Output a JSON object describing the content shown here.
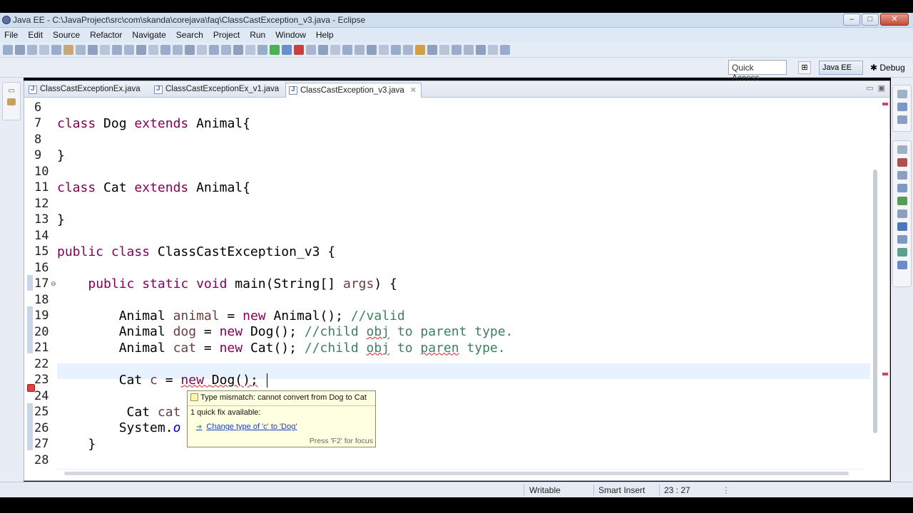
{
  "window": {
    "title": "Java EE - C:\\JavaProject\\src\\com\\skanda\\corejava\\faq\\ClassCastException_v3.java - Eclipse",
    "controls": [
      "–",
      "□",
      "✕"
    ]
  },
  "menu": [
    "File",
    "Edit",
    "Source",
    "Refactor",
    "Navigate",
    "Search",
    "Project",
    "Run",
    "Window",
    "Help"
  ],
  "perspectives": {
    "quick_access": "Quick Access",
    "java_ee": "Java EE",
    "debug": "Debug"
  },
  "tabs": [
    {
      "label": "ClassCastExceptionEx.java"
    },
    {
      "label": "ClassCastExceptionEx_v1.java"
    },
    {
      "label": "ClassCastException_v3.java",
      "close": "✕"
    }
  ],
  "code": {
    "line_numbers": [
      "6",
      "7",
      "8",
      "9",
      "10",
      "11",
      "12",
      "13",
      "14",
      "15",
      "16",
      "17",
      "18",
      "19",
      "20",
      "21",
      "22",
      "23",
      "24",
      "25",
      "26",
      "27",
      "28"
    ]
  },
  "hover": {
    "message": "Type mismatch: cannot convert from Dog to Cat",
    "quick_fix_count": "1 quick fix available:",
    "fix": "Change type of 'c' to 'Dog'",
    "focus_hint": "Press 'F2' for focus"
  },
  "status": {
    "writable": "Writable",
    "insert_mode": "Smart Insert",
    "position": "23 : 27"
  },
  "colors": {
    "keyword": "#7f0055",
    "comment": "#3f7f5f",
    "current_line": "#e8f2fe",
    "hover_bg": "#ffffe1"
  }
}
